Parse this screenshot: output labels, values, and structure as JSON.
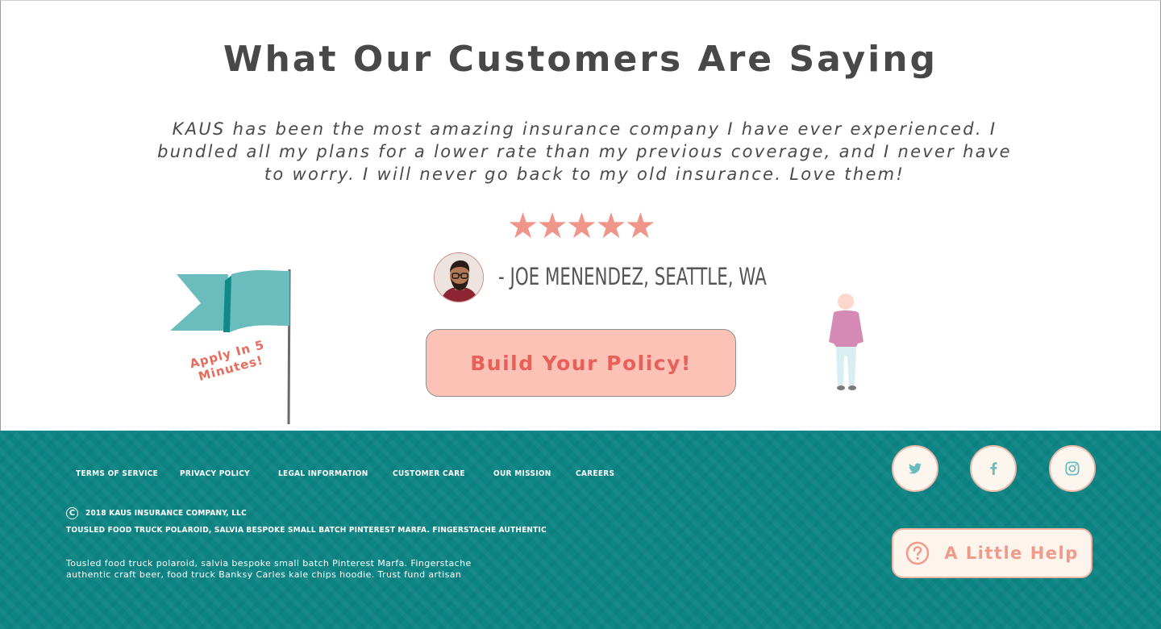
{
  "testimonials": {
    "heading": "What Our Customers Are Saying",
    "quote": "KAUS has been the most amazing insurance company I have ever experienced. I bundled all my plans for a lower rate than my previous coverage, and I never have to worry. I will never go back to my old insurance. Love them!",
    "rating": 5,
    "stars": "★★★★★",
    "attribution": "- Joe Menendez, Seattle, WA",
    "cta_label": "Build Your Policy!",
    "flag_text": "Apply In 5 Minutes!"
  },
  "footer": {
    "nav": [
      {
        "label": "Terms of Service"
      },
      {
        "label": "Privacy Policy"
      },
      {
        "label": "Legal Information"
      },
      {
        "label": "Customer Care"
      },
      {
        "label": "Our Mission"
      },
      {
        "label": "Careers"
      }
    ],
    "copyright_symbol": "C",
    "copyright": "2018 KAUS Insurance Company, LLC",
    "tagline": "Tousled food truck polaroid, salvia bespoke small batch Pinterest Marfa. Fingerstache authentic",
    "blurb": "Tousled food truck polaroid, salvia bespoke small batch Pinterest Marfa. Fingerstache authentic craft beer, food truck Banksy Carles kale chips hoodie. Trust fund artisan",
    "social": [
      {
        "icon": "twitter-icon"
      },
      {
        "icon": "facebook-icon"
      },
      {
        "icon": "instagram-icon"
      }
    ],
    "help_label": "A Little Help"
  },
  "colors": {
    "accent_coral": "#f0958a",
    "cta_fill": "#fbc2b5",
    "footer_teal": "#0d8584",
    "flag_teal": "#6bbcbc"
  }
}
